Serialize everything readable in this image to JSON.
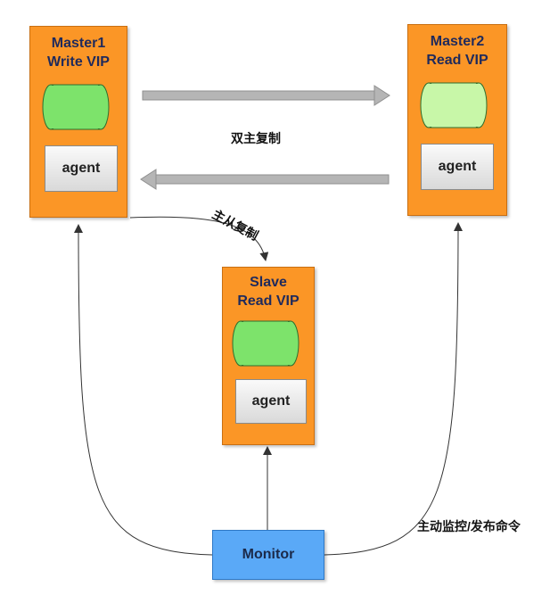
{
  "nodes": {
    "master1": {
      "line1": "Master1",
      "line2": "Write VIP",
      "agent": "agent"
    },
    "master2": {
      "line1": "Master2",
      "line2": "Read VIP",
      "agent": "agent"
    },
    "slave": {
      "line1": "Slave",
      "line2": "Read VIP",
      "agent": "agent"
    }
  },
  "monitor": {
    "label": "Monitor"
  },
  "labels": {
    "dual_master_replication": "双主复制",
    "master_slave_replication": "主从复制",
    "monitor_action": "主动监控/发布命令"
  },
  "colors": {
    "node_fill": "#fb9626",
    "db_fill": "#7de36b",
    "db_fill_light": "#c8f7a8",
    "monitor_fill": "#5aa9f7",
    "arrow_gray": "#b5b5b5"
  }
}
